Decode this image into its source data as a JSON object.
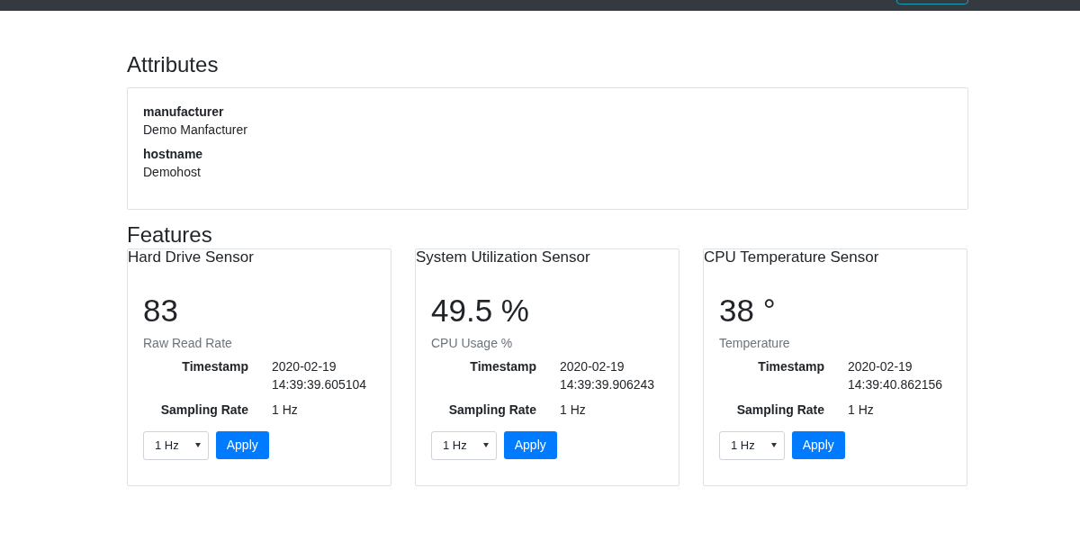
{
  "attributes": {
    "title": "Attributes",
    "items": [
      {
        "name": "manufacturer",
        "value": "Demo Manfacturer"
      },
      {
        "name": "hostname",
        "value": "Demohost"
      }
    ]
  },
  "features": {
    "title": "Features",
    "sensors": [
      {
        "title": "Hard Drive Sensor",
        "value": "83",
        "caption": "Raw Read Rate",
        "fields": [
          {
            "label": "Timestamp",
            "lines": [
              "2020-02-19",
              "14:39:39.605104"
            ]
          },
          {
            "label": "Sampling Rate",
            "lines": [
              "1 Hz"
            ]
          }
        ],
        "rate": "1 Hz",
        "button": "Apply"
      },
      {
        "title": "System Utilization Sensor",
        "value": "49.5 %",
        "caption": "CPU Usage %",
        "fields": [
          {
            "label": "Timestamp",
            "lines": [
              "2020-02-19",
              "14:39:39.906243"
            ]
          },
          {
            "label": "Sampling Rate",
            "lines": [
              "1 Hz"
            ]
          }
        ],
        "rate": "1 Hz",
        "button": "Apply"
      },
      {
        "title": "CPU Temperature Sensor",
        "value": "38 °",
        "caption": "Temperature",
        "fields": [
          {
            "label": "Timestamp",
            "lines": [
              "2020-02-19",
              "14:39:40.862156"
            ]
          },
          {
            "label": "Sampling Rate",
            "lines": [
              "1 Hz"
            ]
          }
        ],
        "rate": "1 Hz",
        "button": "Apply"
      }
    ]
  }
}
